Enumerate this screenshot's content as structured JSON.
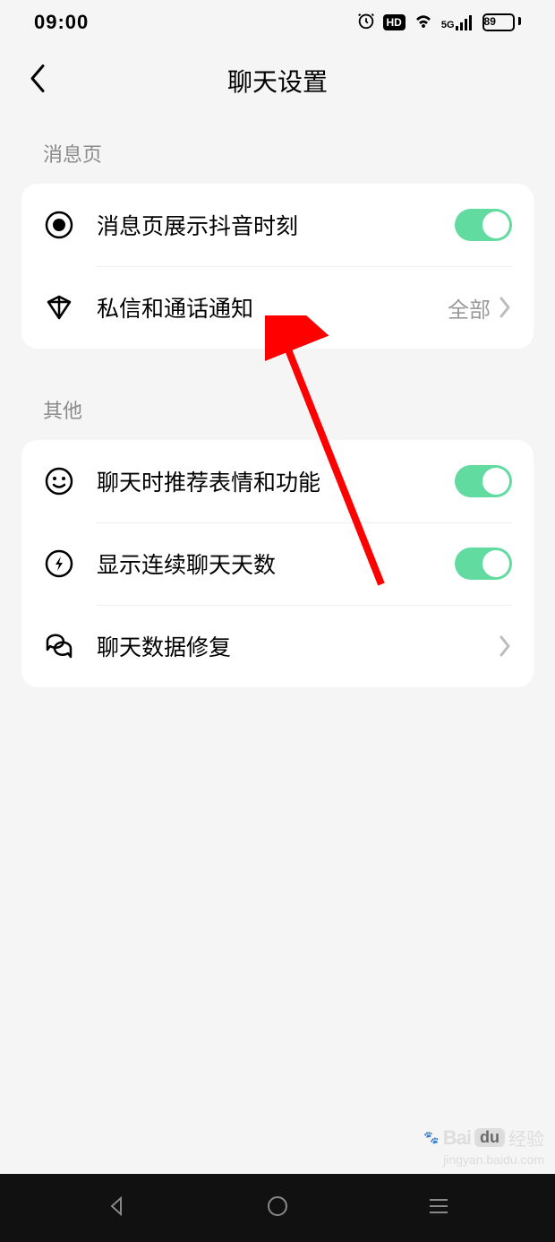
{
  "status": {
    "time": "09:00",
    "battery": "89",
    "network_label": "5G"
  },
  "header": {
    "title": "聊天设置"
  },
  "sections": [
    {
      "label": "消息页",
      "rows": [
        {
          "label": "消息页展示抖音时刻"
        },
        {
          "label": "私信和通话通知",
          "value": "全部"
        }
      ]
    },
    {
      "label": "其他",
      "rows": [
        {
          "label": "聊天时推荐表情和功能"
        },
        {
          "label": "显示连续聊天天数"
        },
        {
          "label": "聊天数据修复"
        }
      ]
    }
  ],
  "watermark": {
    "brand_a": "Bai",
    "brand_b": "du",
    "brand_cn": "经验",
    "url": "jingyan.baidu.com"
  }
}
